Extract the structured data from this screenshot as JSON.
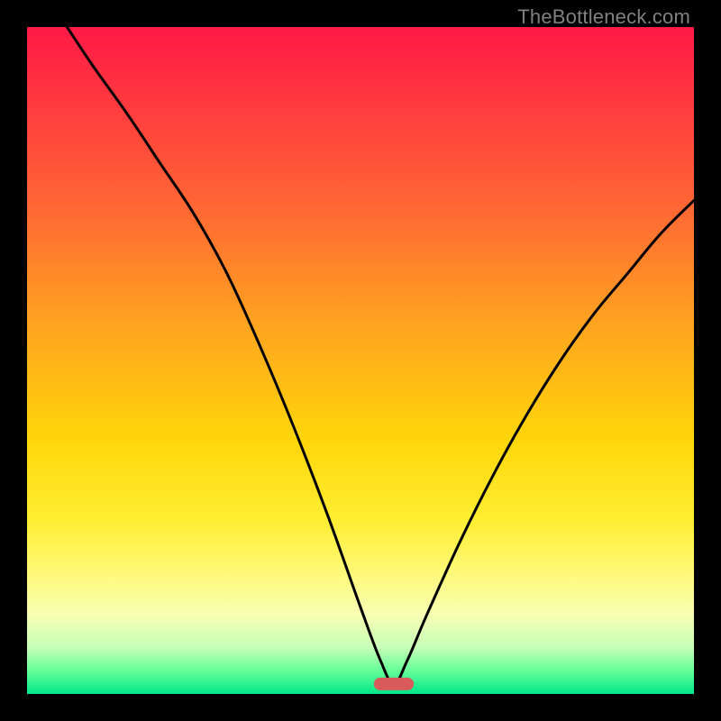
{
  "watermark": {
    "text": "TheBottleneck.com"
  },
  "colors": {
    "frame": "#000000",
    "curve": "#000000",
    "marker": "#d85a5a",
    "gradient_stops": [
      {
        "offset": 0.0,
        "color": "#ff1a46"
      },
      {
        "offset": 0.12,
        "color": "#ff3b3f"
      },
      {
        "offset": 0.28,
        "color": "#ff6a33"
      },
      {
        "offset": 0.45,
        "color": "#ffa51f"
      },
      {
        "offset": 0.62,
        "color": "#ffd60a"
      },
      {
        "offset": 0.74,
        "color": "#ffee33"
      },
      {
        "offset": 0.82,
        "color": "#fff97a"
      },
      {
        "offset": 0.88,
        "color": "#f8ffb3"
      },
      {
        "offset": 0.93,
        "color": "#c8ffb8"
      },
      {
        "offset": 0.965,
        "color": "#66ff99"
      },
      {
        "offset": 1.0,
        "color": "#00e68a"
      }
    ]
  },
  "chart_data": {
    "type": "line",
    "title": "",
    "xlabel": "",
    "ylabel": "",
    "xlim": [
      0,
      100
    ],
    "ylim": [
      0,
      100
    ],
    "marker": {
      "x_range": [
        52,
        58
      ],
      "y": 1.5
    },
    "series": [
      {
        "name": "bottleneck-curve",
        "x": [
          6,
          10,
          15,
          20,
          25,
          30,
          35,
          40,
          45,
          50,
          53,
          55,
          57,
          60,
          65,
          70,
          75,
          80,
          85,
          90,
          95,
          100
        ],
        "values": [
          100,
          94,
          87,
          79.5,
          72,
          63,
          52,
          40,
          27,
          13,
          5,
          1.5,
          5,
          12,
          23,
          33,
          42,
          50,
          57,
          63,
          69,
          74
        ]
      }
    ]
  }
}
